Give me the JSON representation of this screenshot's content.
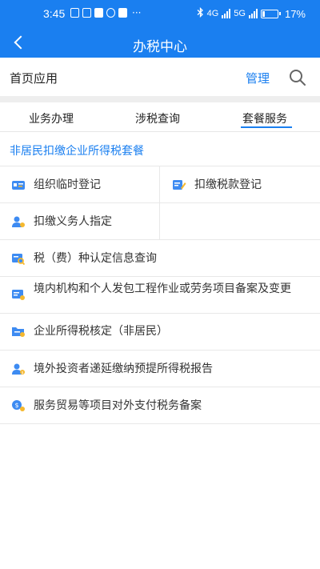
{
  "status_bar": {
    "time": "3:45",
    "battery": "17%",
    "network": "4G",
    "network2": "5G"
  },
  "app_bar": {
    "title": "办税中心"
  },
  "home_apps": {
    "label": "首页应用",
    "manage": "管理"
  },
  "tabs": [
    {
      "label": "业务办理"
    },
    {
      "label": "涉税查询"
    },
    {
      "label": "套餐服务"
    }
  ],
  "active_tab": "套餐服务",
  "package": {
    "title": "非居民扣缴企业所得税套餐",
    "items": [
      {
        "label": "组织临时登记",
        "icon": "id-card-icon"
      },
      {
        "label": "扣缴税款登记",
        "icon": "edit-document-icon"
      },
      {
        "label": "扣缴义务人指定",
        "icon": "user-add-icon"
      },
      {
        "label": "税（费）种认定信息查询",
        "icon": "search-document-icon"
      },
      {
        "label": "境内机构和个人发包工程作业或劳务项目备案及变更",
        "icon": "contract-icon"
      },
      {
        "label": "企业所得税核定（非居民）",
        "icon": "folder-icon"
      },
      {
        "label": "境外投资者递延缴纳预提所得税报告",
        "icon": "investor-icon"
      },
      {
        "label": "服务贸易等项目对外支付税务备案",
        "icon": "payment-icon"
      }
    ]
  },
  "colors": {
    "primary": "#1a7ff0",
    "icon_blue": "#3d8bf2",
    "icon_yellow": "#f5b82e"
  }
}
